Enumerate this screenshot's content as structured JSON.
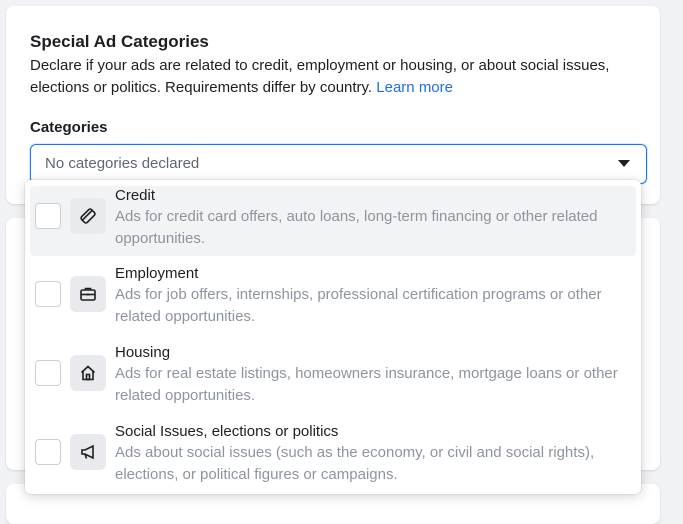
{
  "section": {
    "title": "Special Ad Categories",
    "description": "Declare if your ads are related to credit, employment or housing, or about social issues, elections or politics. Requirements differ by country.",
    "learn_more": "Learn more"
  },
  "categories_field": {
    "label": "Categories",
    "placeholder": "No categories declared"
  },
  "options": [
    {
      "title": "Credit",
      "description": "Ads for credit card offers, auto loans, long-term financing or other related opportunities.",
      "icon": "credit-card-icon",
      "checked": false
    },
    {
      "title": "Employment",
      "description": "Ads for job offers, internships, professional certification programs or other related opportunities.",
      "icon": "briefcase-icon",
      "checked": false
    },
    {
      "title": "Housing",
      "description": "Ads for real estate listings, homeowners insurance, mortgage loans or other related opportunities.",
      "icon": "house-icon",
      "checked": false
    },
    {
      "title": "Social Issues, elections or politics",
      "description": "Ads about social issues (such as the economy, or civil and social rights), elections, or political figures or campaigns.",
      "icon": "megaphone-icon",
      "checked": false
    }
  ],
  "colors": {
    "accent": "#1877f2",
    "link": "#216fdb",
    "muted_text": "#8d949e"
  }
}
